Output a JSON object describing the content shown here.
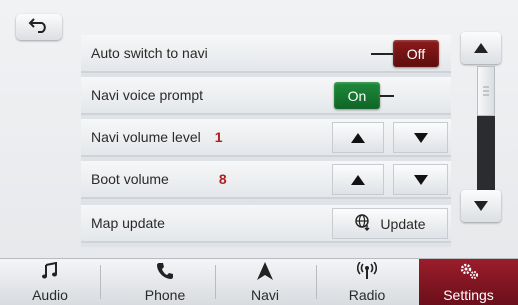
{
  "back": {
    "icon": "back-arrow-icon"
  },
  "settings": {
    "rows": [
      {
        "label": "Auto switch to navi",
        "control": "toggle",
        "state": "Off"
      },
      {
        "label": "Navi voice prompt",
        "control": "toggle",
        "state": "On"
      },
      {
        "label": "Navi volume level",
        "value": "1",
        "control": "stepper"
      },
      {
        "label": "Boot volume",
        "value": "8",
        "control": "stepper"
      },
      {
        "label": "Map update",
        "control": "button",
        "button_label": "Update"
      }
    ]
  },
  "scrollbar": {
    "position": 0.0
  },
  "nav": {
    "items": [
      {
        "label": "Audio",
        "icon": "music-note-icon"
      },
      {
        "label": "Phone",
        "icon": "phone-icon"
      },
      {
        "label": "Navi",
        "icon": "navigation-icon"
      },
      {
        "label": "Radio",
        "icon": "radio-antenna-icon"
      },
      {
        "label": "Settings",
        "icon": "gears-icon",
        "active": true
      }
    ]
  },
  "colors": {
    "off": "#7a1414",
    "on": "#168032",
    "active_tab": "#8a1524",
    "value_text": "#b3201f"
  }
}
